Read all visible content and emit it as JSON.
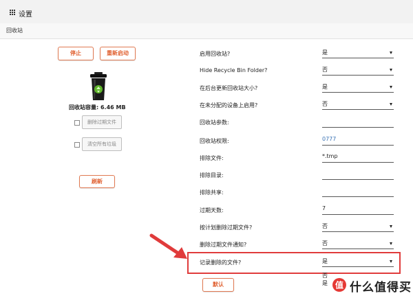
{
  "header": {
    "title": "设置"
  },
  "section": {
    "title": "回收站"
  },
  "left_panel": {
    "stop_label": "停止",
    "restart_label": "重新启动",
    "capacity": "回收站容量: 6.46 MB",
    "clear_expired_label": "删除过期文件",
    "empty_all_label": "清空所有垃圾",
    "refresh_label": "刷新"
  },
  "settings": {
    "enable": {
      "label": "启用回收站?",
      "value": "是"
    },
    "hide": {
      "label": "Hide Recycle Bin Folder?",
      "value": "否"
    },
    "update_size": {
      "label": "在后台更新回收站大小?",
      "value": "是"
    },
    "unassigned": {
      "label": "在未分配的设备上启用?",
      "value": "否"
    },
    "params": {
      "label": "回收站参数:",
      "value": ""
    },
    "permissions": {
      "label": "回收站权限:",
      "value": "0777"
    },
    "exclude_files": {
      "label": "排除文件:",
      "value": "*.tmp"
    },
    "exclude_dirs": {
      "label": "排除目录:",
      "value": ""
    },
    "exclude_shares": {
      "label": "排除共享:",
      "value": ""
    },
    "expire_days": {
      "label": "过期天数:",
      "value": "7"
    },
    "scheduled_delete": {
      "label": "按计划删除过期文件?",
      "value": "否"
    },
    "delete_notify": {
      "label": "删除过期文件通知?",
      "value": "否"
    },
    "log_deleted": {
      "label": "记录删除的文件?",
      "value": "是",
      "options": [
        "否",
        "是"
      ]
    }
  },
  "apply_label": "默认",
  "watermark": {
    "text": "什么值得买"
  },
  "colors": {
    "accent": "#e06030",
    "annotation": "#e03b3b",
    "link_blue": "#3a73b5"
  }
}
